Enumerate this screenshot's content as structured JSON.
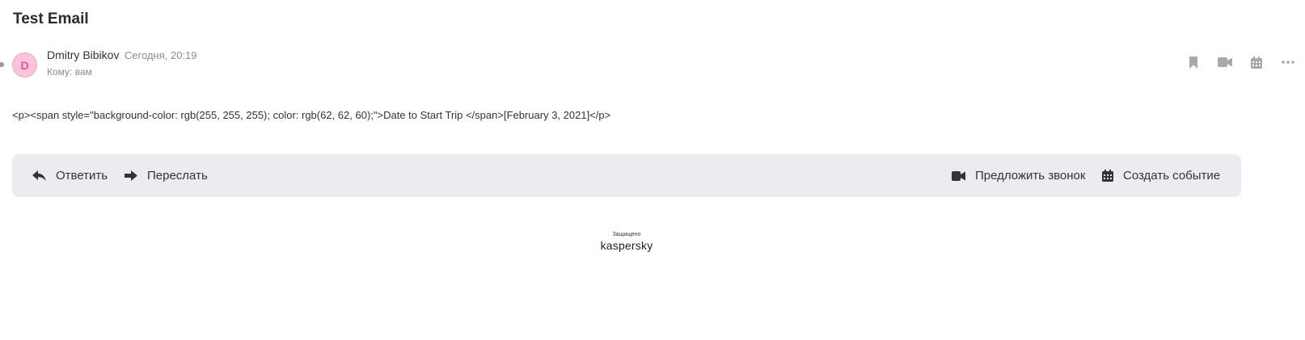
{
  "message": {
    "subject": "Test Email",
    "sender": {
      "avatar_letter": "D",
      "name": "Dmitry Bibikov",
      "date": "Сегодня, 20:19"
    },
    "recipient": "Кому: вам",
    "body": "<p><span style=\"background-color: rgb(255, 255, 255); color: rgb(62, 62, 60);\">Date to Start Trip </span>[February 3, 2021]</p>"
  },
  "header_actions": [
    {
      "icon": "bookmark-icon"
    },
    {
      "icon": "video-camera-icon"
    },
    {
      "icon": "calendar-icon"
    },
    {
      "icon": "more-icon"
    }
  ],
  "action_bar": {
    "reply_label": "Ответить",
    "forward_label": "Переслать",
    "call_label": "Предложить звонок",
    "event_label": "Создать событие"
  },
  "footer": {
    "protected_label": "Защищено",
    "brand": "kaspersky"
  },
  "colors": {
    "avatar_bg": "#f9c4dc",
    "avatar_text": "#e5558d",
    "action_bar_bg": "#ebecef",
    "muted_text": "#8c8c8c"
  }
}
